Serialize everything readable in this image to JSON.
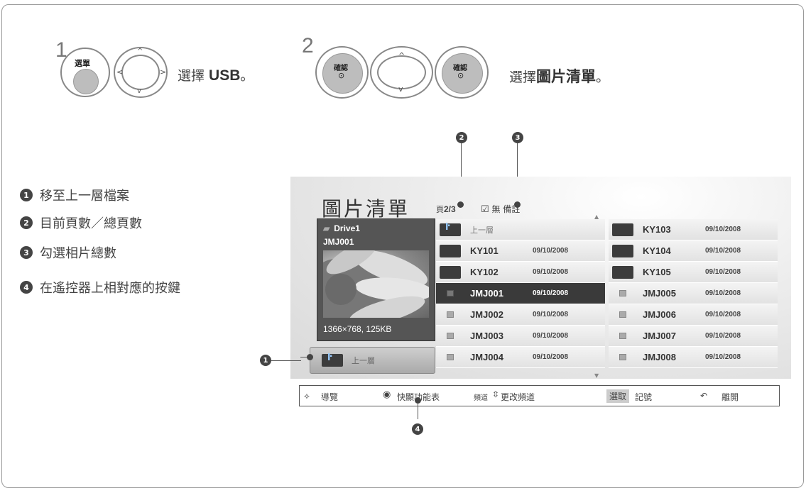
{
  "steps": [
    {
      "num": "1",
      "btn_label": "選單",
      "text_prefix": "選擇 ",
      "text_bold": "USB",
      "text_suffix": "。"
    },
    {
      "num": "2",
      "btn_label": "確認",
      "text_prefix": "選擇",
      "text_bold": "圖片清單",
      "text_suffix": "。"
    }
  ],
  "legend": [
    {
      "num": "1",
      "text": "移至上一層檔案"
    },
    {
      "num": "2",
      "text": "目前頁數／總頁數"
    },
    {
      "num": "3",
      "text": "勾選相片總數"
    },
    {
      "num": "4",
      "text": "在遙控器上相對應的按鍵"
    }
  ],
  "screen": {
    "title": "圖片清單",
    "page_prefix": "頁",
    "page": "2/3",
    "mark_label": "無 備註",
    "preview": {
      "drive": "Drive1",
      "file": "JMJ001",
      "resolution": "1366×768, 125KB"
    },
    "up_button": "上一層",
    "left_col": [
      {
        "name": "上一層",
        "date": "",
        "type": "up",
        "selected": false
      },
      {
        "name": "KY101",
        "date": "09/10/2008",
        "type": "folder",
        "selected": false
      },
      {
        "name": "KY102",
        "date": "09/10/2008",
        "type": "folder",
        "selected": false
      },
      {
        "name": "JMJ001",
        "date": "09/10/2008",
        "type": "file",
        "selected": true
      },
      {
        "name": "JMJ002",
        "date": "09/10/2008",
        "type": "file",
        "selected": false
      },
      {
        "name": "JMJ003",
        "date": "09/10/2008",
        "type": "file",
        "selected": false
      },
      {
        "name": "JMJ004",
        "date": "09/10/2008",
        "type": "file",
        "selected": false
      }
    ],
    "right_col": [
      {
        "name": "KY103",
        "date": "09/10/2008",
        "type": "folder"
      },
      {
        "name": "KY104",
        "date": "09/10/2008",
        "type": "folder"
      },
      {
        "name": "KY105",
        "date": "09/10/2008",
        "type": "folder"
      },
      {
        "name": "JMJ005",
        "date": "09/10/2008",
        "type": "file"
      },
      {
        "name": "JMJ006",
        "date": "09/10/2008",
        "type": "file"
      },
      {
        "name": "JMJ007",
        "date": "09/10/2008",
        "type": "file"
      },
      {
        "name": "JMJ008",
        "date": "09/10/2008",
        "type": "file"
      }
    ]
  },
  "bottom_bar": {
    "nav": "導覽",
    "quick_menu": "快顯功能表",
    "channel_label": "頻道",
    "change_channel": "更改頻道",
    "select_key": "選取",
    "mark": "記號",
    "exit": "離開"
  },
  "callouts": [
    "1",
    "2",
    "3",
    "4"
  ]
}
